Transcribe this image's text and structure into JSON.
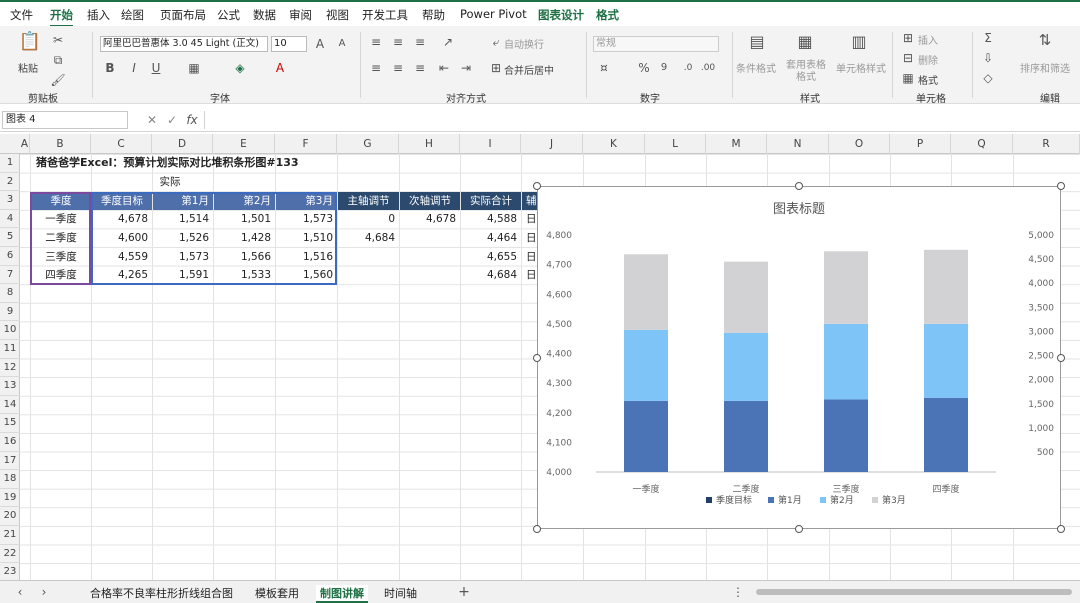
{
  "menu": {
    "items": [
      "文件",
      "开始",
      "插入",
      "绘图",
      "页面布局",
      "公式",
      "数据",
      "审阅",
      "视图",
      "开发工具",
      "帮助",
      "Power Pivot",
      "图表设计",
      "格式"
    ]
  },
  "ribbon": {
    "paste": "粘贴",
    "clipboard": "剪贴板",
    "font_name": "阿里巴巴普惠体 3.0 45 Light (正文)",
    "font_size": "10",
    "font_group": "字体",
    "align_group": "对齐方式",
    "wrap": "自动换行",
    "merge": "合并后居中",
    "number_format": "常规",
    "number_group": "数字",
    "cond_format": "条件格式",
    "table_format": "套用表格格式",
    "cell_style": "单元格样式",
    "style_group": "样式",
    "insert": "插入",
    "delete": "删除",
    "format": "格式",
    "cells_group": "单元格",
    "sort_filter": "排序和筛选",
    "edit_group": "编辑"
  },
  "namebox": "图表 4",
  "columns": [
    "A",
    "B",
    "C",
    "D",
    "E",
    "F",
    "G",
    "H",
    "I",
    "J",
    "K",
    "L",
    "M",
    "N",
    "O",
    "P",
    "Q",
    "R"
  ],
  "rows": [
    "1",
    "2",
    "3",
    "4",
    "5",
    "6",
    "7",
    "8",
    "9",
    "10",
    "11",
    "12",
    "13",
    "14",
    "15",
    "16",
    "17",
    "18",
    "19",
    "20",
    "21",
    "22",
    "23"
  ],
  "sheet": {
    "title": "猪爸爸学Excel：预算计划实际对比堆积条形图#133",
    "actual_label": "实际",
    "headers": [
      "季度",
      "季度目标",
      "第1月",
      "第2月",
      "第3月"
    ],
    "aux_headers": [
      "主轴调节",
      "次轴调节",
      "实际合计",
      "辅"
    ],
    "quarters": [
      "一季度",
      "二季度",
      "三季度",
      "四季度"
    ],
    "target": [
      "4,678",
      "4,600",
      "4,559",
      "4,265"
    ],
    "m1": [
      "1,514",
      "1,526",
      "1,573",
      "1,591"
    ],
    "m2": [
      "1,501",
      "1,428",
      "1,566",
      "1,533"
    ],
    "m3": [
      "1,573",
      "1,510",
      "1,516",
      "1,560"
    ],
    "main_adj": [
      "0",
      "4,684",
      "",
      ""
    ],
    "sub_adj": [
      "4,678",
      "",
      "",
      ""
    ],
    "actual_total": [
      "4,588",
      "4,464",
      "4,655",
      "4,684"
    ],
    "aux": [
      "日",
      "日",
      "日",
      "日"
    ]
  },
  "chart_data": {
    "type": "bar",
    "title": "图表标题",
    "categories": [
      "一季度",
      "二季度",
      "三季度",
      "四季度"
    ],
    "series": [
      {
        "name": "季度目标",
        "values": [
          null,
          null,
          null,
          null
        ],
        "color": "#1f3f66"
      },
      {
        "name": "第1月",
        "values": [
          4240,
          4240,
          4245,
          4250
        ],
        "color": "#4a74b5"
      },
      {
        "name": "第2月",
        "values": [
          4480,
          4470,
          4500,
          4500
        ],
        "color": "#7fc4f6"
      },
      {
        "name": "第3月",
        "values": [
          4735,
          4710,
          4745,
          4750
        ],
        "color": "#d2d2d4"
      }
    ],
    "ylim": [
      4000,
      4800
    ],
    "yticks": [
      "4,000",
      "4,100",
      "4,200",
      "4,300",
      "4,400",
      "4,500",
      "4,600",
      "4,700",
      "4,800"
    ],
    "y2ticks": [
      "500",
      "1,000",
      "1,500",
      "2,000",
      "2,500",
      "3,000",
      "3,500",
      "4,000",
      "4,500",
      "5,000"
    ],
    "legend": "bottom"
  },
  "tabs": [
    "合格率不良率柱形折线组合图",
    "模板套用",
    "制图讲解",
    "时间轴"
  ]
}
